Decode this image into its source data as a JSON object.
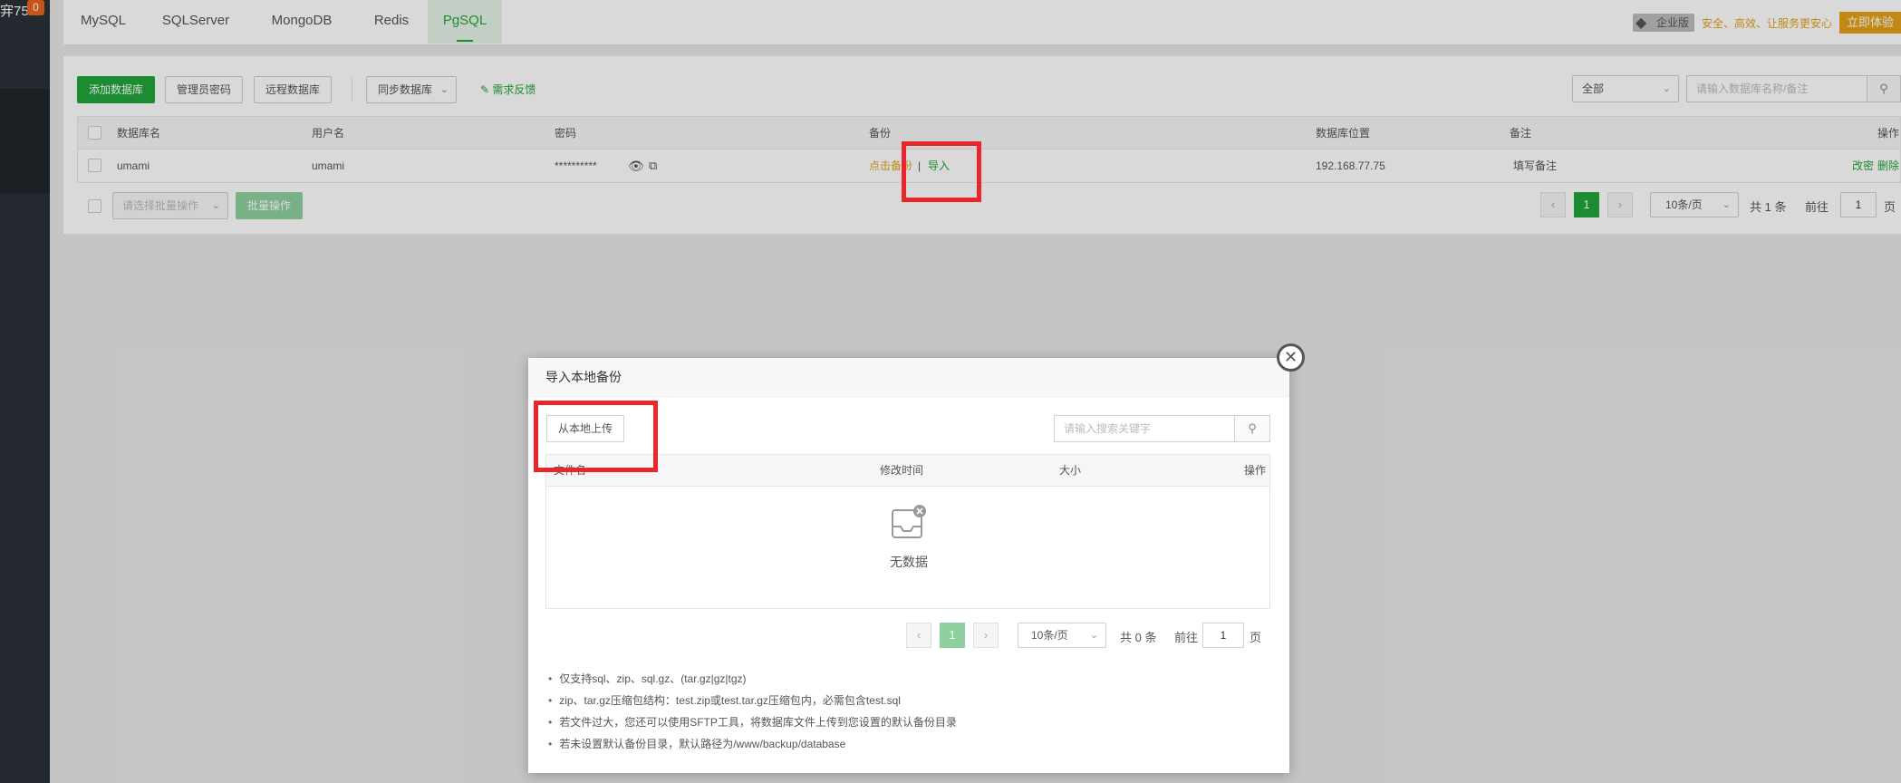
{
  "sidebar": {
    "brand": "宑75",
    "badge": "0"
  },
  "tabs": [
    "MySQL",
    "SQLServer",
    "MongoDB",
    "Redis",
    "PgSQL"
  ],
  "pro": {
    "tag": "企业版",
    "slogan": "安全、高效、让服务更安心",
    "button": "立即体验"
  },
  "toolbar": {
    "add_db": "添加数据库",
    "admin_pwd": "管理员密码",
    "remote_db": "远程数据库",
    "sync_db": "同步数据库",
    "feedback": "需求反馈",
    "filter_value": "全部",
    "search_placeholder": "请输入数据库名称/备注"
  },
  "db_table": {
    "headers": [
      "数据库名",
      "用户名",
      "密码",
      "备份",
      "数据库位置",
      "备注",
      "操作"
    ],
    "row": {
      "name": "umami",
      "user": "umami",
      "password": "**********",
      "backup_link": "点击备份",
      "import_link": "导入",
      "location": "192.168.77.75",
      "remark": "填写备注",
      "action_edit": "改密",
      "action_delete": "删除"
    }
  },
  "batch": {
    "select_placeholder": "请选择批量操作",
    "button": "批量操作"
  },
  "pager": {
    "current": "1",
    "page_size": "10条/页",
    "total": "共 1 条",
    "goto_label": "前往",
    "goto_value": "1",
    "page_unit": "页"
  },
  "modal": {
    "title": "导入本地备份",
    "upload_button": "从本地上传",
    "search_placeholder": "请输入搜索关键字",
    "headers": [
      "文件名",
      "修改时间",
      "大小",
      "操作"
    ],
    "empty_text": "无数据",
    "pager": {
      "current": "1",
      "page_size": "10条/页",
      "total": "共 0 条",
      "goto_label": "前往",
      "goto_value": "1",
      "page_unit": "页"
    },
    "notes": [
      "仅支持sql、zip、sql.gz、(tar.gz|gz|tgz)",
      "zip、tar.gz压缩包结构：test.zip或test.tar.gz压缩包内，必需包含test.sql",
      "若文件过大，您还可以使用SFTP工具，将数据库文件上传到您设置的默认备份目录",
      "若未设置默认备份目录，默认路径为/www/backup/database"
    ]
  },
  "colors": {
    "accent": "#20a53a",
    "warning": "#e4a21a",
    "highlight": "#e8262c",
    "sidebar": "#2a3138"
  }
}
